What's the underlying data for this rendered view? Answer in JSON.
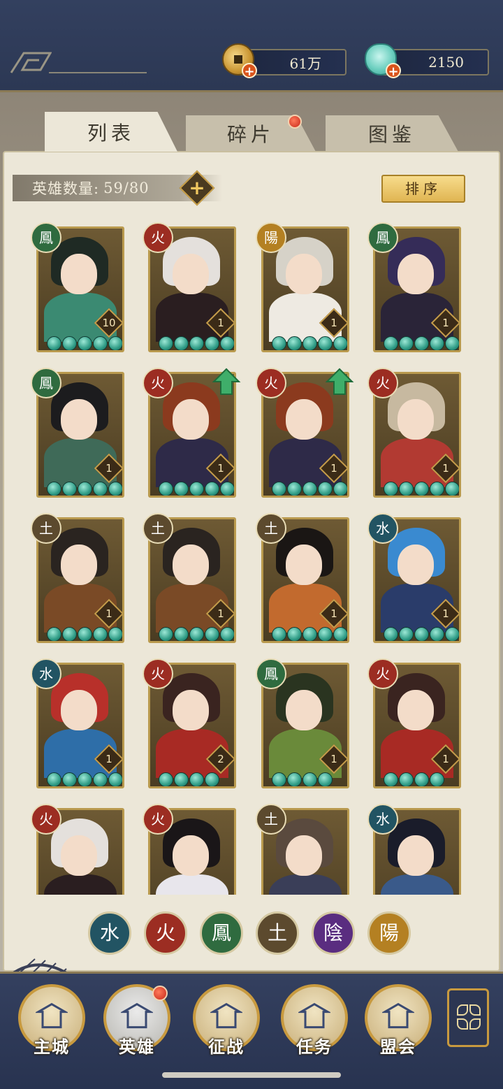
{
  "resources": {
    "coins": "61万",
    "jade": "2150"
  },
  "tabs": [
    {
      "label": "列表",
      "active": true
    },
    {
      "label": "碎片",
      "active": false,
      "badge": true
    },
    {
      "label": "图鉴",
      "active": false
    }
  ],
  "hero_count": {
    "label": "英雄数量:",
    "value": "59/80"
  },
  "sort_label": "排序",
  "heroes": [
    {
      "element": "鳳",
      "elem_class": "el-wind",
      "level": "10",
      "stars": 5,
      "hair": "#1f2a24",
      "body": "#3b8a72"
    },
    {
      "element": "火",
      "elem_class": "el-fire",
      "level": "1",
      "stars": 5,
      "hair": "#e4e0dc",
      "body": "#2a1e20"
    },
    {
      "element": "陽",
      "elem_class": "el-yang",
      "level": "1",
      "stars": 5,
      "hair": "#d6d2c8",
      "body": "#eeeae2"
    },
    {
      "element": "鳳",
      "elem_class": "el-wind",
      "level": "1",
      "stars": 5,
      "hair": "#352c58",
      "body": "#2a2438"
    },
    {
      "element": "鳳",
      "elem_class": "el-wind",
      "level": "1",
      "stars": 5,
      "hair": "#1c1c1e",
      "body": "#3f6a58"
    },
    {
      "element": "火",
      "elem_class": "el-fire",
      "level": "1",
      "stars": 5,
      "hair": "#8b3a1e",
      "body": "#2e2a48",
      "upgrade": true
    },
    {
      "element": "火",
      "elem_class": "el-fire",
      "level": "1",
      "stars": 5,
      "hair": "#8b3a1e",
      "body": "#2e2a48",
      "upgrade": true
    },
    {
      "element": "火",
      "elem_class": "el-fire",
      "level": "1",
      "stars": 5,
      "hair": "#c7b9a0",
      "body": "#b23a32"
    },
    {
      "element": "土",
      "elem_class": "el-earth",
      "level": "1",
      "stars": 5,
      "hair": "#2a2420",
      "body": "#7a4a26"
    },
    {
      "element": "土",
      "elem_class": "el-earth",
      "level": "1",
      "stars": 5,
      "hair": "#2a2420",
      "body": "#7a4a26"
    },
    {
      "element": "土",
      "elem_class": "el-earth",
      "level": "1",
      "stars": 5,
      "hair": "#1a1614",
      "body": "#c26a2e"
    },
    {
      "element": "水",
      "elem_class": "el-water",
      "level": "1",
      "stars": 5,
      "hair": "#3a8ad0",
      "body": "#2a3c6a"
    },
    {
      "element": "水",
      "elem_class": "el-water",
      "level": "1",
      "stars": 5,
      "hair": "#b8302a",
      "body": "#2e6ea8"
    },
    {
      "element": "火",
      "elem_class": "el-fire",
      "level": "2",
      "stars": 4,
      "hair": "#3a2420",
      "body": "#a82a24"
    },
    {
      "element": "鳳",
      "elem_class": "el-wind",
      "level": "1",
      "stars": 4,
      "hair": "#2a3420",
      "body": "#6a8a3a"
    },
    {
      "element": "火",
      "elem_class": "el-fire",
      "level": "1",
      "stars": 4,
      "hair": "#3a2420",
      "body": "#a82a24"
    },
    {
      "element": "火",
      "elem_class": "el-fire",
      "level": "",
      "stars": 0,
      "hair": "#e4e0dc",
      "body": "#2a1e20"
    },
    {
      "element": "火",
      "elem_class": "el-fire",
      "level": "",
      "stars": 0,
      "hair": "#1a1618",
      "body": "#e8e6ec"
    },
    {
      "element": "土",
      "elem_class": "el-earth",
      "level": "",
      "stars": 0,
      "hair": "#5a4a3e",
      "body": "#3a3e58"
    },
    {
      "element": "水",
      "elem_class": "el-water",
      "level": "",
      "stars": 0,
      "hair": "#1a1c2a",
      "body": "#3a5a8a"
    }
  ],
  "filters": [
    {
      "label": "水",
      "cls": "el-water",
      "name": "water"
    },
    {
      "label": "火",
      "cls": "el-fire",
      "name": "fire"
    },
    {
      "label": "鳳",
      "cls": "el-wind",
      "name": "wind"
    },
    {
      "label": "土",
      "cls": "el-earth",
      "name": "earth"
    },
    {
      "label": "陰",
      "cls": "el-yin",
      "name": "yin"
    },
    {
      "label": "陽",
      "cls": "el-yang",
      "name": "yang"
    }
  ],
  "nav": [
    {
      "label": "主城",
      "name": "main-city"
    },
    {
      "label": "英雄",
      "name": "heroes",
      "active": true,
      "badge": true
    },
    {
      "label": "征战",
      "name": "campaign"
    },
    {
      "label": "任务",
      "name": "quests"
    },
    {
      "label": "盟会",
      "name": "alliance"
    }
  ],
  "colors": {
    "topbar": "#2f3b5a",
    "panel": "#ece7d8",
    "gold_border": "#b99a4e",
    "badge_red": "#c7281a",
    "upgrade_green": "#3fae6a"
  }
}
